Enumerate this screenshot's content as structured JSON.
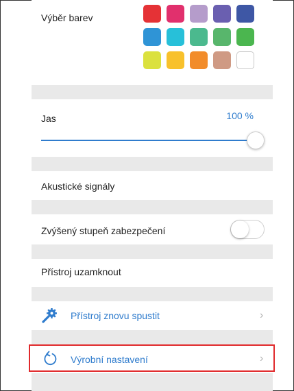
{
  "color_picker": {
    "label": "Výběr barev",
    "swatches": [
      {
        "name": "red",
        "color": "#e53236"
      },
      {
        "name": "pink",
        "color": "#e1306d"
      },
      {
        "name": "lavender",
        "color": "#b59ccb"
      },
      {
        "name": "purple",
        "color": "#6a5fb0"
      },
      {
        "name": "navy",
        "color": "#3e57a5"
      },
      {
        "name": "blue",
        "color": "#2f94d6"
      },
      {
        "name": "cyan",
        "color": "#27c0d9"
      },
      {
        "name": "teal",
        "color": "#4bb98e"
      },
      {
        "name": "green",
        "color": "#58b66c"
      },
      {
        "name": "bright-green",
        "color": "#4bb64f"
      },
      {
        "name": "lime",
        "color": "#dbe13e"
      },
      {
        "name": "yellow",
        "color": "#f8c12c"
      },
      {
        "name": "orange",
        "color": "#f28c2a"
      },
      {
        "name": "tan",
        "color": "#cf9a84"
      },
      {
        "name": "white",
        "color": "#ffffff"
      }
    ]
  },
  "brightness": {
    "label": "Jas",
    "value_text": "100 %",
    "level": 1.0
  },
  "acoustic": {
    "label": "Akustické signály"
  },
  "security": {
    "label": "Zvýšený stupeň zabezpečení",
    "enabled": false
  },
  "lock": {
    "label": "Přístroj uzamknout"
  },
  "restart": {
    "label": "Přístroj znovu spustit",
    "icon": "wrench-gear-icon"
  },
  "factory_reset": {
    "label": "Výrobní nastavení",
    "icon": "refresh-icon"
  },
  "colors": {
    "accent": "#2f7ccd",
    "highlight": "#e0292b",
    "separator": "#e9e9e9"
  }
}
